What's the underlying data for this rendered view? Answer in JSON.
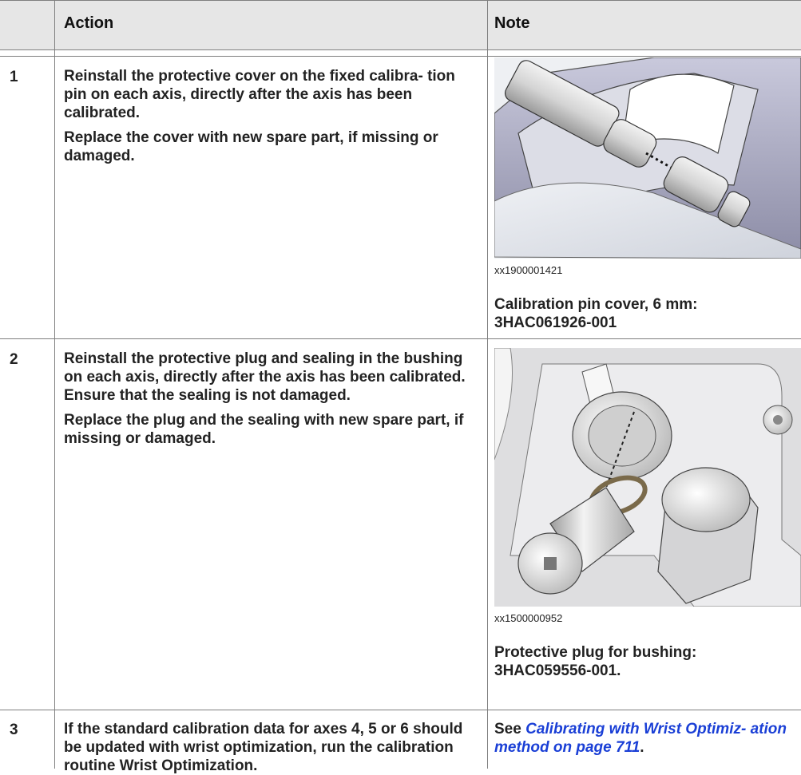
{
  "header": {
    "col_action": "Action",
    "col_note": "Note"
  },
  "rows": [
    {
      "num": "1",
      "action_p1": "Reinstall the protective cover on the fixed calibra- tion pin on each axis, directly after the axis has been calibrated.",
      "action_p2": "Replace the cover with new spare part, if missing or damaged.",
      "image_id": "xx1900001421",
      "note_line1": "Calibration pin cover, 6 mm:",
      "note_line2": "3HAC061926-001"
    },
    {
      "num": "2",
      "action_p1": "Reinstall the protective plug and sealing in the bushing on each axis, directly after the axis has been calibrated. Ensure that the sealing is not damaged.",
      "action_p2": "Replace the plug and the sealing with new spare part, if missing or damaged.",
      "image_id": "xx1500000952",
      "note_line1": "Protective plug for bushing:",
      "note_line2": "3HAC059556-001."
    },
    {
      "num": "3",
      "action_pre": "If the standard calibration data for axes 4, 5 or 6 should be updated with wrist optimization, run the calibration routine ",
      "action_bold": "Wrist Optimization",
      "action_post": ".",
      "note_pre": "See ",
      "note_link": "Calibrating with Wrist Optimiz- ation method on page 711",
      "note_post": "."
    }
  ]
}
